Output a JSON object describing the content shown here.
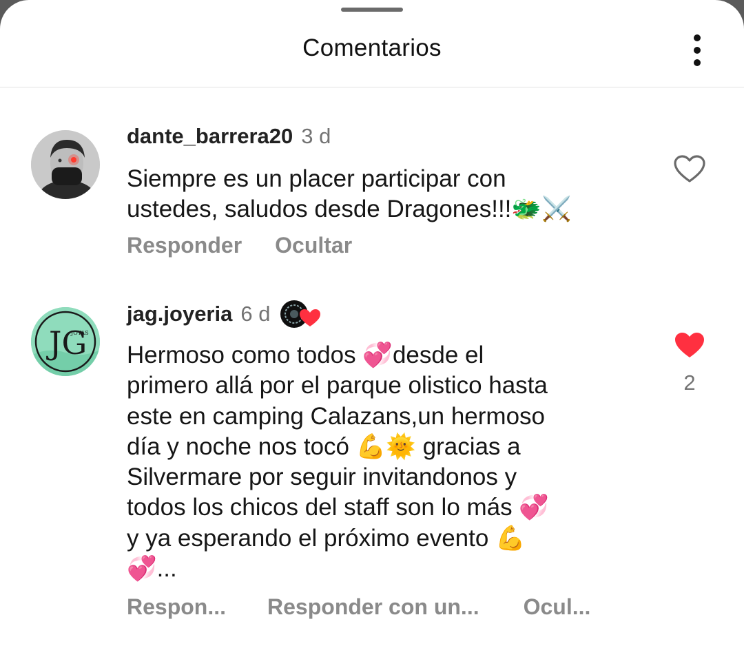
{
  "header": {
    "title": "Comentarios",
    "menu_icon": "more-vertical-icon"
  },
  "comments": [
    {
      "username": "dante_barrera20",
      "time": "3 d",
      "text": "Siempre es un placer participar con\nustedes, saludos desde Dragones!!!🐲⚔️",
      "actions": [
        "Responder",
        "Ocultar"
      ],
      "liked": false,
      "like_count": ""
    },
    {
      "username": "jag.joyeria",
      "time": "6 d",
      "avatar_text": "JG",
      "avatar_subtext": "JOYAS",
      "text": "Hermoso como todos 💞desde  el\nprimero allá por el parque olistico hasta\neste en camping Calazans,un hermoso\ndía y noche nos tocó 💪🌞 gracias a\nSilvermare por seguir invitandonos y\ntodos los chicos del staff son lo más 💞\ny ya esperando el próximo evento 💪\n💞...",
      "actions": [
        "Respon...",
        "Responder con un...",
        "Ocul..."
      ],
      "liked": true,
      "like_count": "2"
    }
  ],
  "colors": {
    "like_red": "#ff3040",
    "muted": "#737373",
    "action_gray": "#8a8a8a"
  }
}
